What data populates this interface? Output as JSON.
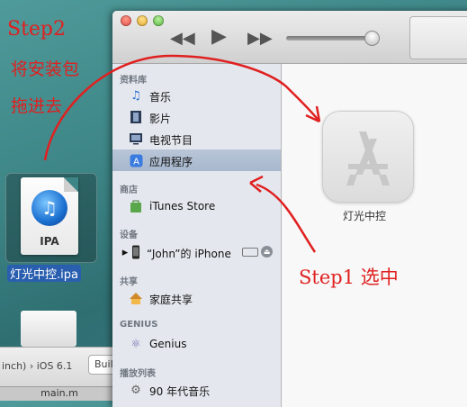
{
  "annotations": {
    "step2": "Step2",
    "step2_line1": "将安装包",
    "step2_line2": "拖进去",
    "step1": "Step1 选中"
  },
  "desktop": {
    "file_badge": "IPA",
    "file_name": "灯光中控.ipa"
  },
  "xcode": {
    "device": "inch) › iOS 6.1",
    "build_label": "Buil",
    "bottom_file": "main.m"
  },
  "sidebar": {
    "library_header": "资料库",
    "library_items": [
      "音乐",
      "影片",
      "电视节目",
      "应用程序"
    ],
    "store_header": "商店",
    "store_item": "iTunes Store",
    "devices_header": "设备",
    "device_item": "“John”的 iPhone",
    "shared_header": "共享",
    "shared_item": "家庭共享",
    "genius_header": "GENIUS",
    "genius_item": "Genius",
    "playlists_header": "播放列表",
    "playlist_item": "90 年代音乐"
  },
  "main": {
    "app_name": "灯光中控"
  },
  "colors": {
    "annotation": "#e02020",
    "selected_row": "#a7b7cd"
  }
}
